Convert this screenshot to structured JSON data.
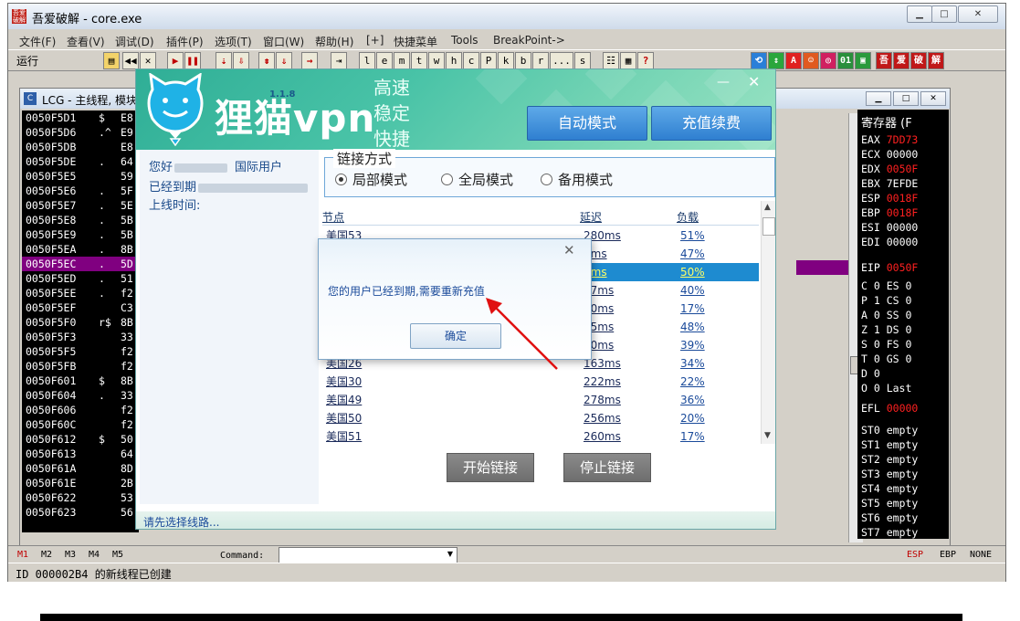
{
  "olly": {
    "title": "吾爱破解 - core.exe",
    "logo_text": "吾爱破解",
    "menu": [
      "文件(F)",
      "查看(V)",
      "调试(D)",
      "插件(P)",
      "选项(T)",
      "窗口(W)",
      "帮助(H)",
      "[+]",
      "快捷菜单",
      "Tools",
      "BreakPoint->"
    ],
    "run_label": "运行",
    "toolbar_letters": [
      "l",
      "e",
      "m",
      "t",
      "w",
      "h",
      "c",
      "P",
      "k",
      "b",
      "r",
      "...",
      "s"
    ],
    "toolbar_right": [
      "吾",
      "爱",
      "破",
      "解"
    ],
    "cpu_title": "LCG - 主线程, 模块",
    "registers_title": "寄存器 (F",
    "disasm_rows": [
      {
        "addr": "0050F5D1",
        "sym": "$",
        "byte": "E8"
      },
      {
        "addr": "0050F5D6",
        "sym": ".^",
        "byte": "E9"
      },
      {
        "addr": "0050F5DB",
        "sym": "",
        "byte": "E8"
      },
      {
        "addr": "0050F5DE",
        "sym": ".",
        "byte": "64"
      },
      {
        "addr": "0050F5E5",
        "sym": "",
        "byte": "59"
      },
      {
        "addr": "0050F5E6",
        "sym": ".",
        "byte": "5F"
      },
      {
        "addr": "0050F5E7",
        "sym": ".",
        "byte": "5E"
      },
      {
        "addr": "0050F5E8",
        "sym": ".",
        "byte": "5B"
      },
      {
        "addr": "0050F5E9",
        "sym": ".",
        "byte": "5B"
      },
      {
        "addr": "0050F5EA",
        "sym": ".",
        "byte": "8B"
      },
      {
        "addr": "0050F5EC",
        "sym": ".",
        "byte": "5D"
      },
      {
        "addr": "0050F5ED",
        "sym": ".",
        "byte": "51"
      },
      {
        "addr": "0050F5EE",
        "sym": ".",
        "byte": "f2"
      },
      {
        "addr": "0050F5EF",
        "sym": "",
        "byte": "C3"
      },
      {
        "addr": "0050F5F0",
        "sym": "r$",
        "byte": "8B"
      },
      {
        "addr": "0050F5F3",
        "sym": "",
        "byte": "33"
      },
      {
        "addr": "0050F5F5",
        "sym": "",
        "byte": "f2"
      },
      {
        "addr": "0050F5FB",
        "sym": "",
        "byte": "f2"
      },
      {
        "addr": "0050F601",
        "sym": "$",
        "byte": "8B"
      },
      {
        "addr": "0050F604",
        "sym": ".",
        "byte": "33"
      },
      {
        "addr": "0050F606",
        "sym": "",
        "byte": "f2"
      },
      {
        "addr": "0050F60C",
        "sym": "",
        "byte": "f2"
      },
      {
        "addr": "0050F612",
        "sym": "$",
        "byte": "50"
      },
      {
        "addr": "0050F613",
        "sym": "",
        "byte": "64"
      },
      {
        "addr": "0050F61A",
        "sym": "",
        "byte": "8D"
      },
      {
        "addr": "0050F61E",
        "sym": "",
        "byte": "2B"
      },
      {
        "addr": "0050F622",
        "sym": "",
        "byte": "53"
      },
      {
        "addr": "0050F623",
        "sym": "",
        "byte": "56"
      }
    ],
    "registers": [
      {
        "name": "EAX",
        "val": "7DD73"
      },
      {
        "name": "ECX",
        "val": "00000"
      },
      {
        "name": "EDX",
        "val": "0050F"
      },
      {
        "name": "EBX",
        "val": "7EFDE"
      },
      {
        "name": "ESP",
        "val": "0018F"
      },
      {
        "name": "EBP",
        "val": "0018F"
      },
      {
        "name": "ESI",
        "val": "00000"
      },
      {
        "name": "EDI",
        "val": "00000"
      },
      {
        "name": "EIP",
        "val": "0050F"
      }
    ],
    "flags": [
      "C 0  ES 0",
      "P 1  CS 0",
      "A 0  SS 0",
      "Z 1  DS 0",
      "S 0  FS 0",
      "T 0  GS 0",
      "D 0",
      "O 0  Last"
    ],
    "efl": {
      "name": "EFL",
      "val": "00000"
    },
    "fpu": [
      "ST0 empty",
      "ST1 empty",
      "ST2 empty",
      "ST3 empty",
      "ST4 empty",
      "ST5 empty",
      "ST6 empty",
      "ST7 empty"
    ],
    "mem_tabs": [
      "M1",
      "M2",
      "M3",
      "M4",
      "M5"
    ],
    "command_label": "Command:",
    "right_tabs": [
      "ESP",
      "EBP",
      "NONE"
    ],
    "status": "ID 000002B4 的新线程已创建"
  },
  "vpn": {
    "logo": "狸猫vpn",
    "version": "1.1.8",
    "slogans": [
      "高速",
      "稳定",
      "快捷"
    ],
    "auto_mode": "自动模式",
    "recharge": "充值续费",
    "greeting": "您好",
    "user_type": "国际用户",
    "expired_label": "已经到期",
    "online_label": "上线时间:",
    "conn_legend": "链接方式",
    "modes": [
      "局部模式",
      "全局模式",
      "备用模式"
    ],
    "columns": {
      "name": "节点",
      "latency": "延迟",
      "load": "负载"
    },
    "nodes": [
      {
        "name": "美国53",
        "latency": "280ms",
        "load": "51%"
      },
      {
        "name": "",
        "latency": "1ms",
        "load": "47%"
      },
      {
        "name": "",
        "latency": "0ms",
        "load": "50%"
      },
      {
        "name": "",
        "latency": "07ms",
        "load": "40%"
      },
      {
        "name": "",
        "latency": "70ms",
        "load": "17%"
      },
      {
        "name": "",
        "latency": "65ms",
        "load": "48%"
      },
      {
        "name": "",
        "latency": "80ms",
        "load": "39%"
      },
      {
        "name": "美国26",
        "latency": "163ms",
        "load": "34%"
      },
      {
        "name": "美国30",
        "latency": "222ms",
        "load": "22%"
      },
      {
        "name": "美国49",
        "latency": "278ms",
        "load": "36%"
      },
      {
        "name": "美国50",
        "latency": "256ms",
        "load": "20%"
      },
      {
        "name": "美国51",
        "latency": "260ms",
        "load": "17%"
      }
    ],
    "start": "开始链接",
    "stop": "停止链接",
    "status": "请先选择线路..."
  },
  "dialog": {
    "message": "您的用户已经到期,需要重新充值",
    "ok": "确定"
  },
  "colors": {
    "vpn_accent": "#2fae96",
    "selection": "#1e8bd0",
    "olly_selected_row": "#800080",
    "reg_changed": "#ff2020"
  }
}
